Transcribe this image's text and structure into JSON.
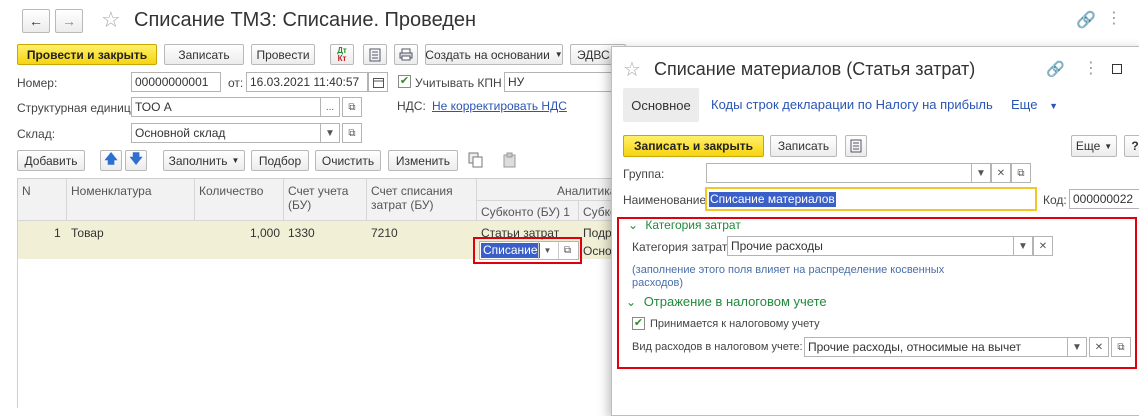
{
  "main": {
    "title": "Списание ТМЗ: Списание. Проведен",
    "toolbar": {
      "post_close": "Провести и закрыть",
      "save": "Записать",
      "post": "Провести",
      "dt_kt_top": "Дт",
      "dt_kt_bottom": "Кт",
      "create_based": "Создать на основании",
      "edvs": "ЭДВС"
    },
    "fields": {
      "number_label": "Номер:",
      "number_value": "00000000001",
      "from_label": "от:",
      "date_value": "16.03.2021 11:40:57",
      "kpn_label": "Учитывать КПН",
      "kpn_value": "НУ",
      "unit_label": "Структурная единица:",
      "unit_value": "ТОО А",
      "vat_label": "НДС:",
      "vat_link": "Не корректировать НДС",
      "warehouse_label": "Склад:",
      "warehouse_value": "Основной склад"
    },
    "table_toolbar": {
      "add": "Добавить",
      "fill": "Заполнить",
      "pick": "Подбор",
      "clear": "Очистить",
      "change": "Изменить"
    },
    "table": {
      "headers": {
        "n": "N",
        "nomenclature": "Номенклатура",
        "quantity": "Количество",
        "account": "Счет учета (БУ)",
        "cost_account": "Счет списания затрат (БУ)",
        "analytics": "Аналитика",
        "subconto1": "Субконто (БУ) 1",
        "subconto2": "Субко"
      },
      "row": {
        "n": "1",
        "nomenclature": "Товар",
        "quantity": "1,000",
        "account": "1330",
        "cost_account": "7210",
        "subconto1": "Статьи затрат",
        "subconto1_value": "Списание",
        "subconto2_a": "Подр",
        "subconto2_b": "Осно"
      }
    }
  },
  "dialog": {
    "title": "Списание материалов (Статья затрат)",
    "tabs": {
      "main": "Основное",
      "codes": "Коды строк декларации по Налогу на прибыль",
      "more": "Еще"
    },
    "toolbar": {
      "save_close": "Записать и закрыть",
      "save": "Записать",
      "more": "Еще",
      "help": "?"
    },
    "fields": {
      "group_label": "Группа:",
      "group_value": "",
      "name_label": "Наименование:",
      "name_value": "Списание материалов",
      "code_label": "Код:",
      "code_value": "000000022"
    },
    "section_category": {
      "title": "Категория затрат",
      "label": "Категория затрат:",
      "value": "Прочие расходы",
      "note_line1": "(заполнение этого поля влияет на распределение косвенных",
      "note_line2": "расходов)"
    },
    "section_tax": {
      "title": "Отражение в налоговом учете",
      "check_label": "Принимается к налоговому учету",
      "type_label": "Вид расходов в налоговом учете:",
      "type_value": "Прочие расходы, относимые на вычет"
    }
  },
  "colors": {
    "accent_yellow": "#f6d411",
    "link_blue": "#2a55b5",
    "section_green": "#1f8a3a",
    "highlight_red": "#e0000b",
    "selection_blue": "#3a5fc8"
  }
}
